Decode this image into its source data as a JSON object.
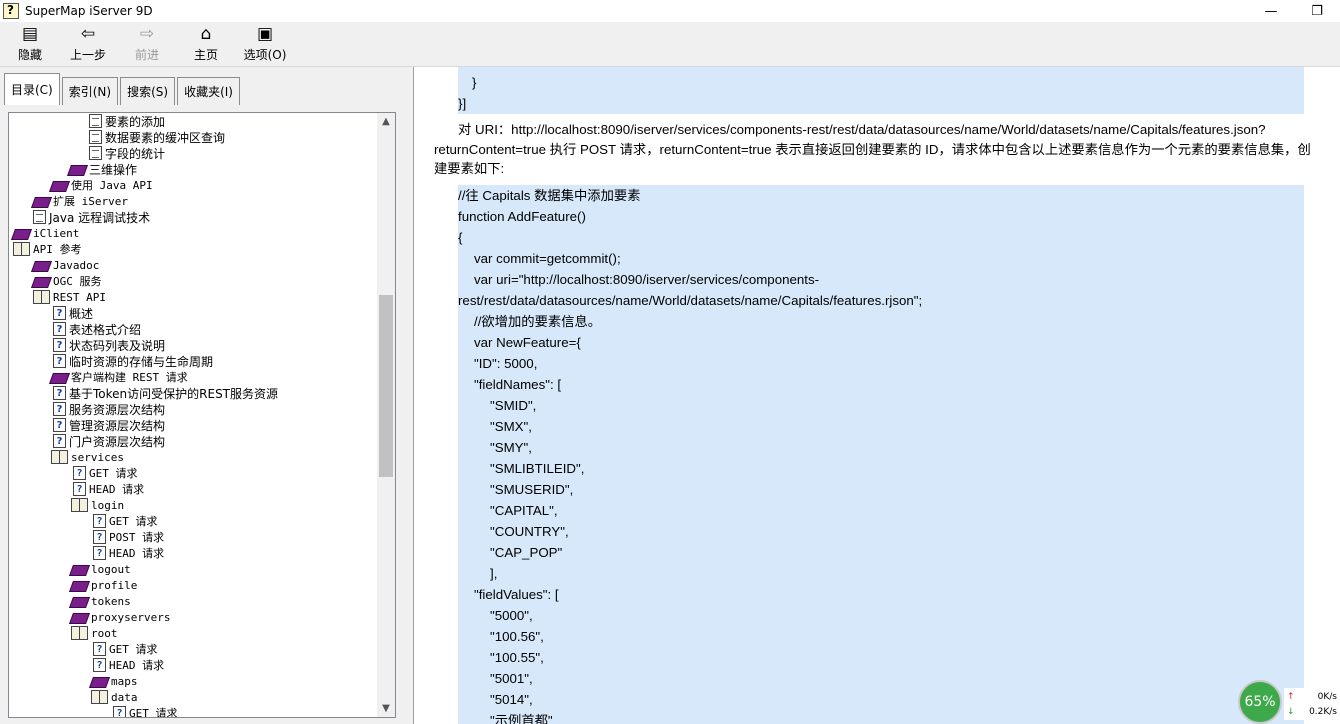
{
  "window": {
    "title": "SuperMap iServer 9D",
    "minimize": "—",
    "restore": "❐"
  },
  "toolbar": [
    {
      "label": "隐藏",
      "icon": "hide-icon"
    },
    {
      "label": "上一步",
      "icon": "back-icon"
    },
    {
      "label": "前进",
      "icon": "forward-icon"
    },
    {
      "label": "主页",
      "icon": "home-icon"
    },
    {
      "label": "选项(O)",
      "icon": "options-icon"
    }
  ],
  "tabs": [
    "目录(C)",
    "索引(N)",
    "搜索(S)",
    "收藏夹(I)"
  ],
  "tree": [
    {
      "label": "要素的添加",
      "icon": "page",
      "mono": false
    },
    {
      "label": "数据要素的缓冲区查询",
      "icon": "page",
      "mono": false
    },
    {
      "label": "字段的统计",
      "icon": "page",
      "mono": false
    },
    {
      "label": "三维操作",
      "icon": "book",
      "mono": false
    },
    {
      "label": "使用 Java API",
      "icon": "book",
      "mono": true
    },
    {
      "label": "扩展 iServer",
      "icon": "book",
      "mono": true
    },
    {
      "label": "Java 远程调试技术",
      "icon": "page",
      "mono": false
    },
    {
      "label": "iClient",
      "icon": "book",
      "mono": true
    },
    {
      "label": "API 参考",
      "icon": "open",
      "mono": true
    },
    {
      "label": "Javadoc",
      "icon": "book",
      "mono": true
    },
    {
      "label": "OGC 服务",
      "icon": "book",
      "mono": true
    },
    {
      "label": "REST API",
      "icon": "open",
      "mono": true
    },
    {
      "label": "概述",
      "icon": "help",
      "mono": false
    },
    {
      "label": "表述格式介绍",
      "icon": "help",
      "mono": false
    },
    {
      "label": "状态码列表及说明",
      "icon": "help",
      "mono": false
    },
    {
      "label": "临时资源的存储与生命周期",
      "icon": "help",
      "mono": false
    },
    {
      "label": "客户端构建 REST 请求",
      "icon": "book",
      "mono": true
    },
    {
      "label": "基于Token访问受保护的REST服务资源",
      "icon": "help",
      "mono": false
    },
    {
      "label": "服务资源层次结构",
      "icon": "help",
      "mono": false
    },
    {
      "label": "管理资源层次结构",
      "icon": "help",
      "mono": false
    },
    {
      "label": "门户资源层次结构",
      "icon": "help",
      "mono": false
    },
    {
      "label": "services",
      "icon": "open",
      "mono": true
    },
    {
      "label": "GET 请求",
      "icon": "help",
      "mono": true
    },
    {
      "label": "HEAD 请求",
      "icon": "help",
      "mono": true
    },
    {
      "label": "login",
      "icon": "open",
      "mono": true
    },
    {
      "label": "GET 请求",
      "icon": "help",
      "mono": true
    },
    {
      "label": "POST 请求",
      "icon": "help",
      "mono": true
    },
    {
      "label": "HEAD 请求",
      "icon": "help",
      "mono": true
    },
    {
      "label": "logout",
      "icon": "book",
      "mono": true
    },
    {
      "label": "profile",
      "icon": "book",
      "mono": true
    },
    {
      "label": "tokens",
      "icon": "book",
      "mono": true
    },
    {
      "label": "proxyservers",
      "icon": "book",
      "mono": true
    },
    {
      "label": "root",
      "icon": "open",
      "mono": true
    },
    {
      "label": "GET 请求",
      "icon": "help",
      "mono": true
    },
    {
      "label": "HEAD 请求",
      "icon": "help",
      "mono": true
    },
    {
      "label": "maps",
      "icon": "book",
      "mono": true
    },
    {
      "label": "data",
      "icon": "open",
      "mono": true
    },
    {
      "label": "GET 请求",
      "icon": "help",
      "mono": true
    }
  ],
  "content": {
    "top_code": [
      "    }",
      "}]"
    ],
    "paragraph": "对 URI：http://localhost:8090/iserver/services/components-rest/rest/data/datasources/name/World/datasets/name/Capitals/features.json?returnContent=true 执行 POST 请求，returnContent=true 表示直接返回创建要素的 ID，请求体中包含以上述要素信息作为一个元素的要素信息集，创建要素如下:",
    "code": [
      "//往 Capitals 数据集中添加要素",
      "function AddFeature()",
      "{",
      "    var commit=getcommit();",
      "    var uri=\"http://localhost:8090/iserver/services/components-",
      "rest/rest/data/datasources/name/World/datasets/name/Capitals/features.rjson\";",
      "    //欲增加的要素信息。",
      "    var NewFeature={",
      "    \"ID\": 5000,",
      "    \"fieldNames\": [",
      "        \"SMID\",",
      "        \"SMX\",",
      "        \"SMY\",",
      "        \"SMLIBTILEID\",",
      "        \"SMUSERID\",",
      "        \"CAPITAL\",",
      "        \"COUNTRY\",",
      "        \"CAP_POP\"",
      "        ],",
      "    \"fieldValues\": [",
      "        \"5000\",",
      "        \"100.56\",",
      "        \"100.55\",",
      "        \"5001\",",
      "        \"5014\",",
      "        \"示例首都\""
    ]
  },
  "net": {
    "percent": "65%",
    "up": "0K/s",
    "down": "0.2K/s"
  }
}
